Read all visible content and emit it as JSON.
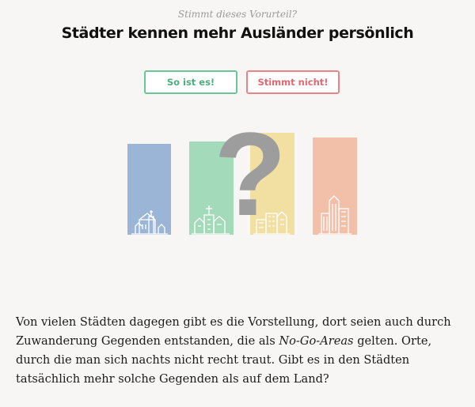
{
  "question": {
    "kicker": "Stimmt dieses Vorurteil?",
    "title": "Städter kennen mehr Ausländer persönlich"
  },
  "answers": {
    "yes_label": "So ist es!",
    "no_label": "Stimmt nicht!"
  },
  "illustration": {
    "question_mark": "?",
    "colors": {
      "blue": "#9bb5d6",
      "green": "#a3dab9",
      "yellow": "#f2dfa2",
      "salmon": "#f2bfa8",
      "question_mark": "#9d9d9d",
      "yes": "#6cc49a",
      "no": "#e8838a"
    }
  },
  "paragraph": {
    "before": "Von vielen Städten dagegen gibt es die Vorstellung, dort seien auch durch Zuwanderung Gegenden entstanden, die als ",
    "emphasis": "No-Go-Areas",
    "after": " gelten. Orte, durch die man sich nachts nicht recht traut. Gibt es in den Städten tatsächlich mehr solche Gegenden als auf dem Land?"
  }
}
